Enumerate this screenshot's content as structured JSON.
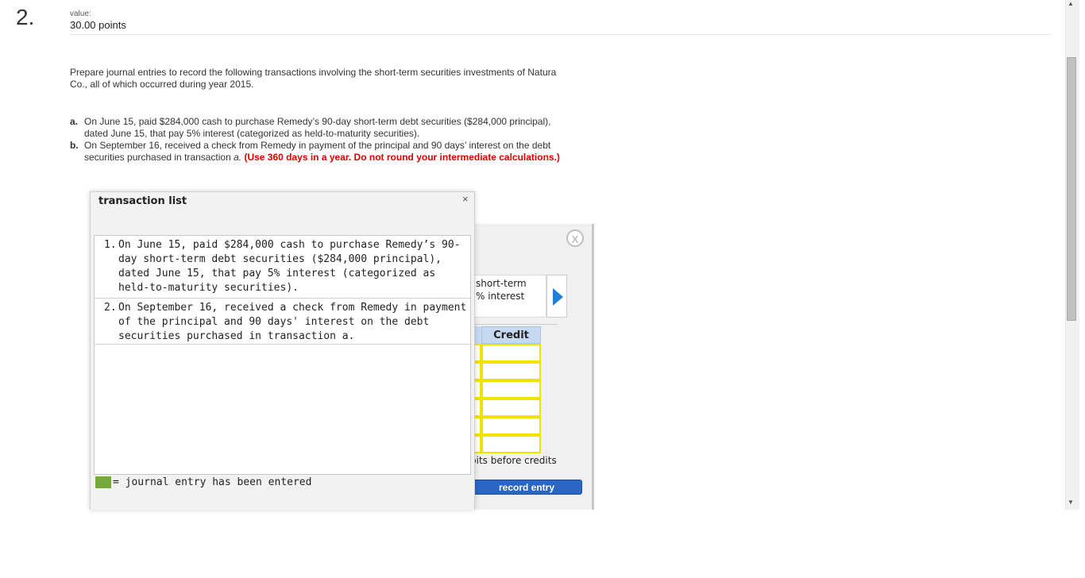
{
  "question": {
    "number": "2.",
    "value_label": "value:",
    "points": "30.00 points"
  },
  "intro": "Prepare journal entries to record the following transactions involving the short-term securities investments of Natura Co., all of which occurred during year 2015.",
  "items": [
    {
      "letter": "a.",
      "text": "On June 15, paid $284,000 cash to purchase Remedy’s 90-day short-term debt securities ($284,000 principal), dated June 15, that pay 5% interest (categorized as held-to-maturity securities)."
    },
    {
      "letter": "b.",
      "text": "On September 16, received a check from Remedy in payment of the principal and 90 days’ interest on the debt securities purchased in transaction ",
      "text_italic": "a.",
      "text_red": " (Use 360 days in a year. Do not round your intermediate calculations.)"
    }
  ],
  "entry_panel": {
    "close_label": "X",
    "desc_line1": "short-term",
    "desc_line2": "% interest",
    "credit_header": "Credit",
    "note": "bits before credits",
    "record_button": "record entry",
    "credit_rows": 6
  },
  "transaction_list": {
    "title": "transaction list",
    "close": "×",
    "rows": [
      {
        "num": "1.",
        "text": "On June 15, paid $284,000 cash to purchase Remedy’s 90-day short-term debt securities ($284,000 principal), dated June 15, that pay 5% interest (categorized as held-to-maturity securities)."
      },
      {
        "num": "2.",
        "text": "On September 16, received a check from Remedy in payment of the principal and 90 days' interest on the debt securities purchased in transaction a."
      }
    ],
    "legend": "= journal entry has been entered",
    "legend_color": "#77a83a"
  },
  "colors": {
    "accent_blue": "#2a66c4",
    "cell_border": "#f2e200",
    "header_bg": "#c5d9f1",
    "red_text": "#e00000"
  }
}
